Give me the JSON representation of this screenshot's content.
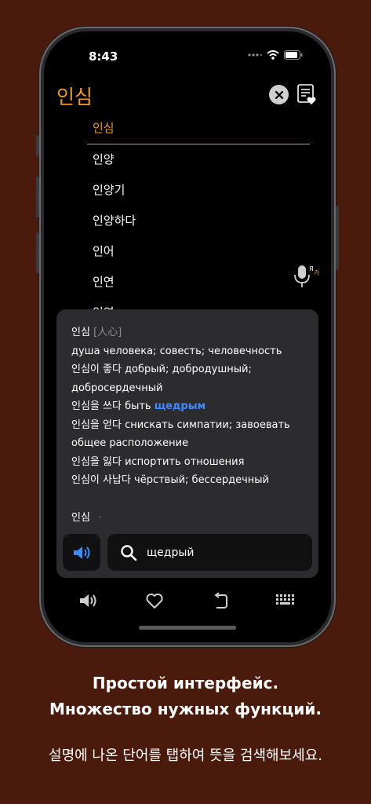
{
  "status": {
    "time": "8:43"
  },
  "header": {
    "title": "인심"
  },
  "list": [
    "인심",
    "인양",
    "인양기",
    "인양하다",
    "인어",
    "인연",
    "인연"
  ],
  "popup": {
    "headword": "인심",
    "hanja": "[人心]",
    "lines": [
      "душа человека; совесть; человечность",
      "인심이 좋다 добрый; добродушный;",
      "добросердечный",
      "인심을 쓰다 быть ",
      "щедрым",
      "인심을 얻다 снискать симпатии; завоевать",
      "общее расположение",
      "인심을 잃다 испортить отношения",
      "인심이 사납다 чёрствый; бессердечный"
    ],
    "second_headword": "인심",
    "second_dot": "·"
  },
  "search": {
    "query": "щедрый"
  },
  "caption": {
    "line1": "Простой интерфейс.",
    "line2": "Множество нужных функций.",
    "line3": "설명에 나온 단어를 탭하여 뜻을 검색해보세요."
  },
  "colors": {
    "accent": "#f19a1f",
    "link": "#3d8bff",
    "background": "#4a1b0c"
  },
  "icons": [
    "clear-icon",
    "note-heart-icon",
    "microphone-translate-icon",
    "speaker-icon",
    "search-icon",
    "heart-icon",
    "undo-icon",
    "keyboard-icon"
  ]
}
